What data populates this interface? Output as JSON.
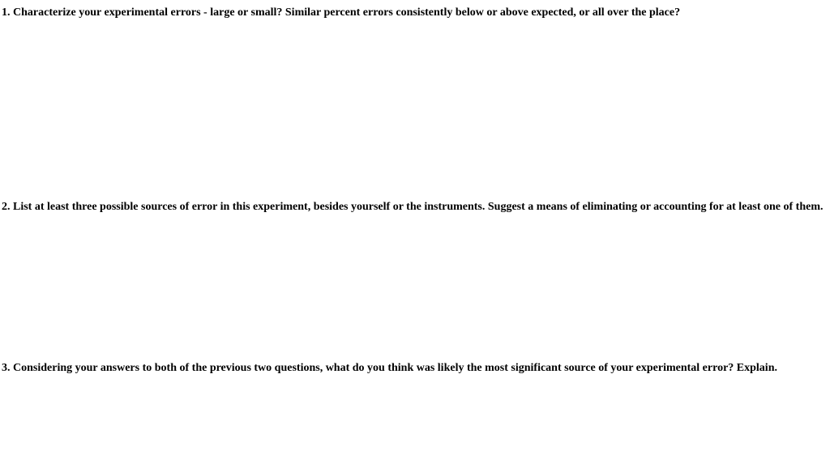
{
  "questions": {
    "q1": "1. Characterize your experimental errors - large or small? Similar percent errors consistently below or above expected, or all over the place?",
    "q2": "2. List at least three possible sources of error in this experiment, besides yourself or the instruments. Suggest a means of eliminating or accounting for at least one of them.",
    "q3": "3. Considering your answers to both of the previous two questions, what do you think was likely the most significant source of your experimental error? Explain."
  }
}
